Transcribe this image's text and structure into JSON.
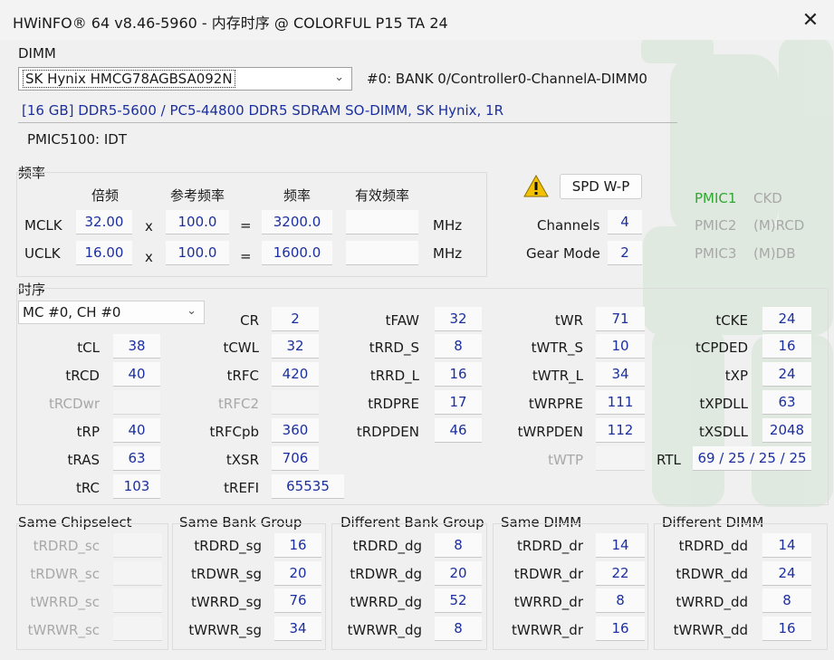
{
  "window": {
    "title": "HWiNFO® 64 v8.46-5960 - 内存时序 @ COLORFUL P15 TA 24",
    "close_glyph": "✕"
  },
  "dimm": {
    "section_label": "DIMM",
    "module": "SK Hynix HMCG78AGBSA092N",
    "slot": "#0: BANK 0/Controller0-ChannelA-DIMM0",
    "description": "[16 GB] DDR5-5600 / PC5-44800 DDR5 SDRAM SO-DIMM, SK Hynix, 1R",
    "pmic": "PMIC5100: IDT"
  },
  "freq": {
    "section_label": "频率",
    "col_mult": "倍频",
    "col_ref": "参考频率",
    "col_freq": "频率",
    "col_eff": "有效频率",
    "x": "x",
    "eq": "=",
    "unit": "MHz",
    "rows": [
      {
        "label": "MCLK",
        "mult": "32.00",
        "ref": "100.0",
        "freq": "3200.0",
        "eff": ""
      },
      {
        "label": "UCLK",
        "mult": "16.00",
        "ref": "100.0",
        "freq": "1600.0",
        "eff": ""
      }
    ],
    "spd_button": "SPD W-P",
    "channels_label": "Channels",
    "channels": "4",
    "gear_label": "Gear Mode",
    "gear": "2"
  },
  "pmic_list": [
    {
      "name": "PMIC1",
      "type": "CKD",
      "color": "#2ea82e"
    },
    {
      "name": "PMIC2",
      "type": "(M)RCD",
      "color": "#a8a8a8"
    },
    {
      "name": "PMIC3",
      "type": "(M)DB",
      "color": "#a8a8a8"
    }
  ],
  "timing": {
    "section_label": "时序",
    "channel_select": "MC #0, CH #0",
    "tCL": "38",
    "tRCD": "40",
    "tRCDwr": "",
    "tRP": "40",
    "tRAS": "63",
    "tRC": "103",
    "CR": "2",
    "tCWL": "32",
    "tRFC": "420",
    "tRFC2": "",
    "tRFCpb": "360",
    "tXSR": "706",
    "tREFI": "65535",
    "tFAW": "32",
    "tRRD_S": "8",
    "tRRD_L": "16",
    "tRDPRE": "17",
    "tRDPDEN": "46",
    "tWR": "71",
    "tWTR_S": "10",
    "tWTR_L": "34",
    "tWRPRE": "111",
    "tWRPDEN": "112",
    "tWTP": "",
    "tCKE": "24",
    "tCPDED": "16",
    "tXP": "24",
    "tXPDLL": "63",
    "tXSDLL": "2048",
    "RTL": "69 / 25 / 25 / 25"
  },
  "groups": [
    {
      "title": "Same Chipselect",
      "suffix": "sc",
      "values": [
        "",
        "",
        "",
        ""
      ],
      "disabled": true
    },
    {
      "title": "Same Bank Group",
      "suffix": "sg",
      "values": [
        "16",
        "20",
        "76",
        "34"
      ],
      "disabled": false
    },
    {
      "title": "Different Bank Group",
      "suffix": "dg",
      "values": [
        "8",
        "20",
        "52",
        "8"
      ],
      "disabled": false
    },
    {
      "title": "Same DIMM",
      "suffix": "dr",
      "values": [
        "14",
        "22",
        "8",
        "16"
      ],
      "disabled": false
    },
    {
      "title": "Different DIMM",
      "suffix": "dd",
      "values": [
        "14",
        "24",
        "8",
        "16"
      ],
      "disabled": false
    }
  ],
  "group_labels": {
    "sc": [
      "tRDRD_sc",
      "tRDWR_sc",
      "tWRRD_sc",
      "tWRWR_sc"
    ],
    "sg": [
      "tRDRD_sg",
      "tRDWR_sg",
      "tWRRD_sg",
      "tWRWR_sg"
    ],
    "dg": [
      "tRDRD_dg",
      "tRDWR_dg",
      "tWRRD_dg",
      "tWRWR_dg"
    ],
    "dr": [
      "tRDRD_dr",
      "tRDWR_dr",
      "tWRRD_dr",
      "tWRWR_dr"
    ],
    "dd": [
      "tRDRD_dd",
      "tRDWR_dd",
      "tWRRD_dd",
      "tWRWR_dd"
    ]
  },
  "timing_labels": {
    "tCL": "tCL",
    "tRCD": "tRCD",
    "tRCDwr": "tRCDwr",
    "tRP": "tRP",
    "tRAS": "tRAS",
    "tRC": "tRC",
    "CR": "CR",
    "tCWL": "tCWL",
    "tRFC": "tRFC",
    "tRFC2": "tRFC2",
    "tRFCpb": "tRFCpb",
    "tXSR": "tXSR",
    "tREFI": "tREFI",
    "tFAW": "tFAW",
    "tRRD_S": "tRRD_S",
    "tRRD_L": "tRRD_L",
    "tRDPRE": "tRDPRE",
    "tRDPDEN": "tRDPDEN",
    "tWR": "tWR",
    "tWTR_S": "tWTR_S",
    "tWTR_L": "tWTR_L",
    "tWRPRE": "tWRPRE",
    "tWRPDEN": "tWRPDEN",
    "tWTP": "tWTP",
    "tCKE": "tCKE",
    "tCPDED": "tCPDED",
    "tXP": "tXP",
    "tXPDLL": "tXPDLL",
    "tXSDLL": "tXSDLL",
    "RTL": "RTL"
  }
}
